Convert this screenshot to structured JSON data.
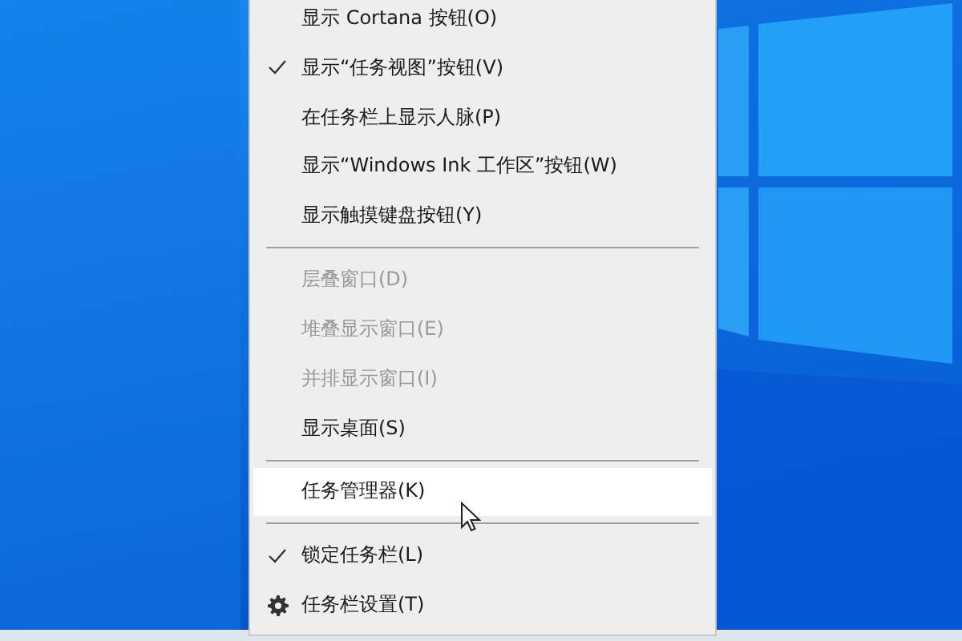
{
  "menu": {
    "items": [
      {
        "kind": "item",
        "label": "显示 Cortana 按钮(O)",
        "checked": false,
        "disabled": false,
        "selected": false
      },
      {
        "kind": "item",
        "label": "显示“任务视图”按钮(V)",
        "checked": true,
        "disabled": false,
        "selected": false
      },
      {
        "kind": "item",
        "label": "在任务栏上显示人脉(P)",
        "checked": false,
        "disabled": false,
        "selected": false
      },
      {
        "kind": "item",
        "label": "显示“Windows Ink 工作区”按钮(W)",
        "checked": false,
        "disabled": false,
        "selected": false
      },
      {
        "kind": "item",
        "label": "显示触摸键盘按钮(Y)",
        "checked": false,
        "disabled": false,
        "selected": false
      },
      {
        "kind": "separator"
      },
      {
        "kind": "item",
        "label": "层叠窗口(D)",
        "checked": false,
        "disabled": true,
        "selected": false
      },
      {
        "kind": "item",
        "label": "堆叠显示窗口(E)",
        "checked": false,
        "disabled": true,
        "selected": false
      },
      {
        "kind": "item",
        "label": "并排显示窗口(I)",
        "checked": false,
        "disabled": true,
        "selected": false
      },
      {
        "kind": "item",
        "label": "显示桌面(S)",
        "checked": false,
        "disabled": false,
        "selected": false
      },
      {
        "kind": "separator"
      },
      {
        "kind": "item",
        "label": "任务管理器(K)",
        "checked": false,
        "disabled": false,
        "selected": true
      },
      {
        "kind": "separator"
      },
      {
        "kind": "item",
        "label": "锁定任务栏(L)",
        "checked": true,
        "disabled": false,
        "selected": false
      },
      {
        "kind": "gear",
        "label": "任务栏设置(T)",
        "disabled": false,
        "selected": false
      }
    ]
  }
}
